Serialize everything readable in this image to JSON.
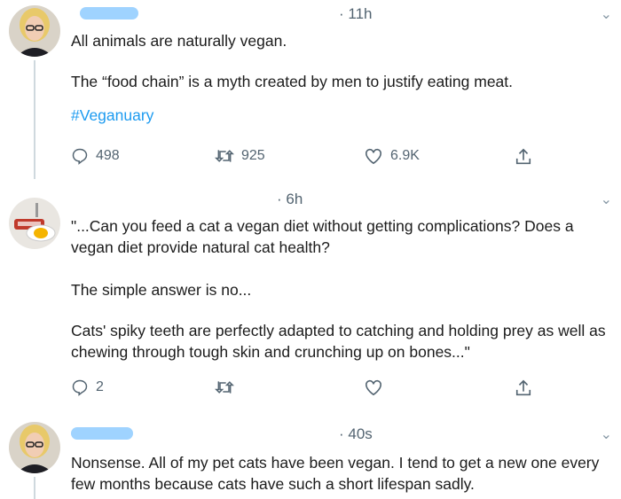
{
  "tweets": [
    {
      "time": "· 11h",
      "lines": [
        "All animals are naturally vegan.",
        "The “food chain” is a myth created by men to justify eating meat."
      ],
      "hashtag": "#Veganuary",
      "actions": {
        "reply": "498",
        "retweet": "925",
        "like": "6.9K"
      }
    },
    {
      "time": "· 6h",
      "lines": [
        "\"...Can you feed a cat a vegan diet without getting complications? Does a vegan diet provide natural cat health?",
        "The simple answer is no...",
        "Cats' spiky teeth are perfectly adapted to catching and holding prey as well as chewing through tough skin and crunching up on bones...\""
      ],
      "actions": {
        "reply": "2",
        "retweet": "",
        "like": ""
      }
    },
    {
      "time": "· 40s",
      "lines": [
        "Nonsense. All of my pet cats have been vegan. I tend to get a new one every few months because cats have such a short lifespan sadly."
      ]
    }
  ],
  "colors": {
    "hashtag": "#1d9bf0",
    "muted": "#536471",
    "name_redaction": "#9fd3ff"
  },
  "icons": [
    "reply-icon",
    "retweet-icon",
    "like-icon",
    "share-icon",
    "chevron-down-icon"
  ]
}
